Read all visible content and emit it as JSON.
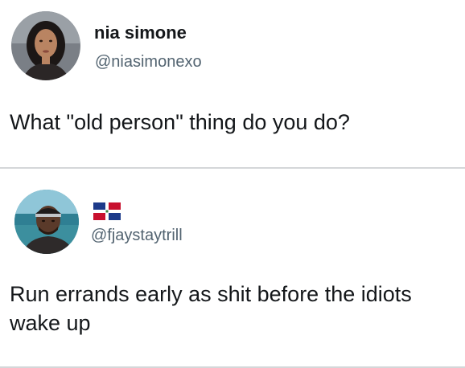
{
  "posts": [
    {
      "display_name": "nia simone",
      "handle": "@niasimonexo",
      "text": "What \"old person\" thing do you do?",
      "avatar_icon": "profile-photo-woman"
    },
    {
      "display_name_icon": "dominican-republic-flag-icon",
      "handle": "@fjaystaytrill",
      "text": "Run errands early as shit before the idiots wake up",
      "avatar_icon": "profile-photo-man"
    }
  ],
  "colors": {
    "text": "#14171a",
    "handle": "#536471",
    "background": "#ffffff"
  }
}
